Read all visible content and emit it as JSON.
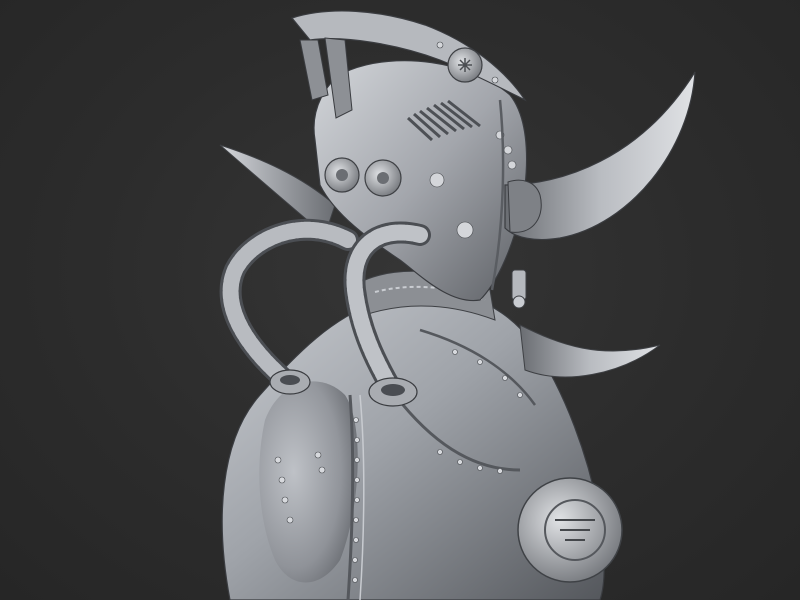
{
  "scene": {
    "background_color": "#2b2b2b",
    "material_color": "#9a9da3",
    "material_shadow": "#3e4044",
    "material_highlight": "#d9dce0",
    "subject": "sculpted-bust"
  }
}
